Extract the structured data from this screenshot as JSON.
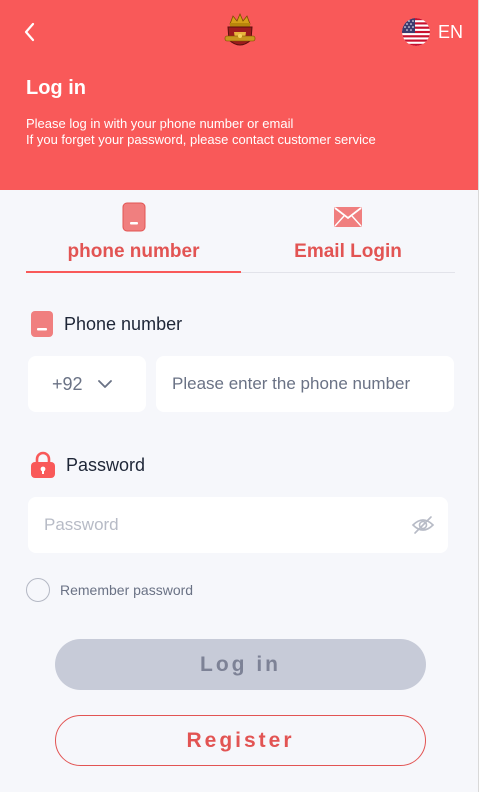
{
  "header": {
    "title": "Log in",
    "subtitle_line1": "Please log in with your phone number or email",
    "subtitle_line2": "If you forget your password, please contact customer service",
    "language": "EN",
    "back_icon": "chevron-left-icon",
    "logo_icon": "crown-crest-logo",
    "flag_icon": "us-flag-icon"
  },
  "tabs": [
    {
      "label": "phone number",
      "icon": "phone-icon",
      "active": true
    },
    {
      "label": "Email Login",
      "icon": "envelope-icon",
      "active": false
    }
  ],
  "phone_field": {
    "label": "Phone number",
    "country_code": "+92",
    "placeholder": "Please enter the phone number",
    "value": ""
  },
  "password_field": {
    "label": "Password",
    "placeholder": "Password",
    "value": ""
  },
  "remember": {
    "label": "Remember password",
    "checked": false
  },
  "buttons": {
    "login": "Log in",
    "register": "Register"
  },
  "colors": {
    "brand": "#f95959",
    "accent_text": "#e25453",
    "background": "#f6f7fb",
    "disabled_button": "#c7cbd8"
  }
}
